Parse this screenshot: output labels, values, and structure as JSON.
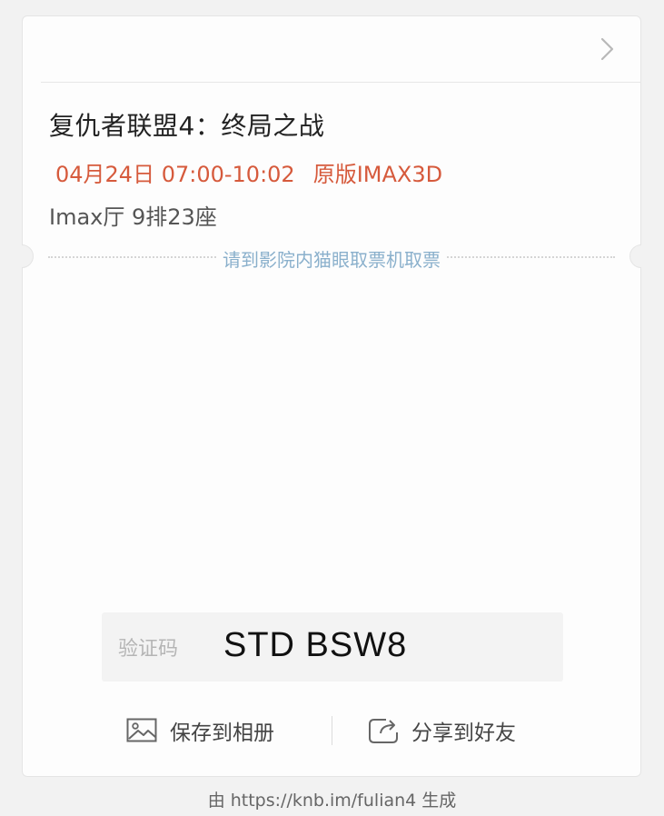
{
  "ticket": {
    "title": "复仇者联盟4：终局之战",
    "date_time": "04月24日 07:00-10:02",
    "version": "原版IMAX3D",
    "seat": "Imax厅 9排23座",
    "pickup_tip": "请到影院内猫眼取票机取票"
  },
  "verification": {
    "label": "验证码",
    "code": "STD BSW8"
  },
  "actions": {
    "save_label": "保存到相册",
    "share_label": "分享到好友"
  },
  "footer": {
    "text": "由 https://knb.im/fulian4 生成"
  },
  "colors": {
    "accent_red": "#d65a3c",
    "tip_blue": "#8ab0cc"
  },
  "icons": {
    "header": "chevron-right-icon",
    "save": "image-icon",
    "share": "share-icon"
  }
}
